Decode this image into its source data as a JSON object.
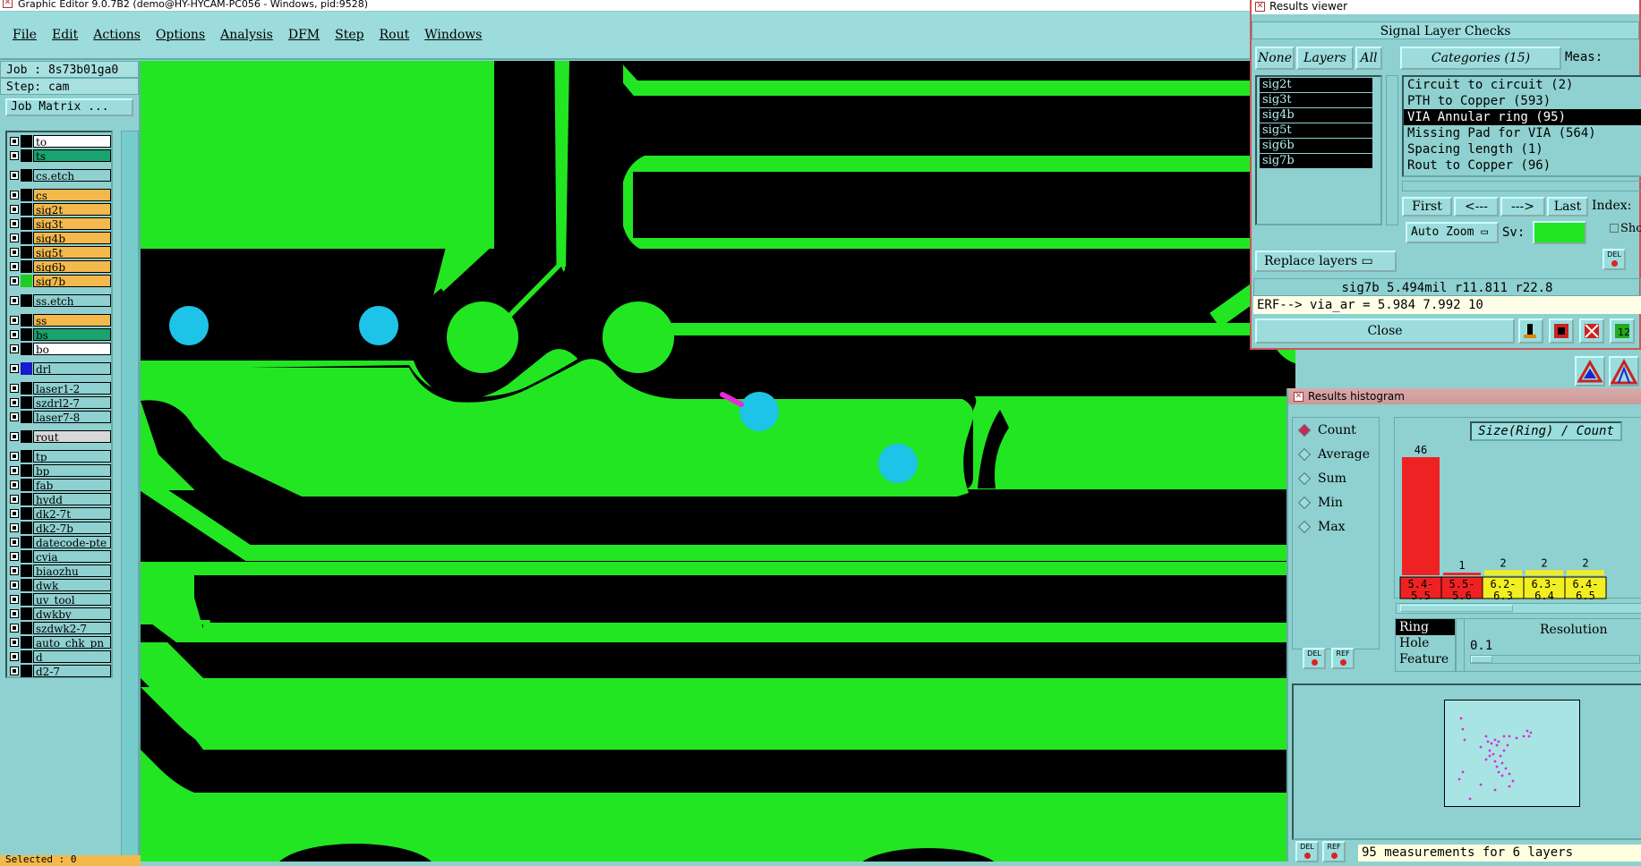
{
  "window": {
    "title": "Graphic Editor 9.0.7B2 (demo@HY-HYCAM-PC056 - Windows, pid:9528)"
  },
  "menu": [
    "File",
    "Edit",
    "Actions",
    "Options",
    "Analysis",
    "DFM",
    "Step",
    "Rout",
    "Windows"
  ],
  "job": {
    "job_line": "Job : 8s73b01ga0",
    "step_line": "Step: cam",
    "matrix_button": "Job Matrix ..."
  },
  "layers": [
    {
      "name": "to",
      "color": "#ffffff",
      "swatch": "#000000"
    },
    {
      "name": "ts",
      "color": "#1aa36f",
      "swatch": "#000000"
    },
    {
      "gap": true
    },
    {
      "name": "cs.etch",
      "color": "#8fd0d0",
      "swatch": "#000000"
    },
    {
      "gap": true
    },
    {
      "name": "cs",
      "color": "#f3b94c",
      "swatch": "#000000"
    },
    {
      "name": "sig2t",
      "color": "#f3b94c",
      "swatch": "#000000"
    },
    {
      "name": "sig3t",
      "color": "#f3b94c",
      "swatch": "#000000"
    },
    {
      "name": "sig4b",
      "color": "#f3b94c",
      "swatch": "#000000"
    },
    {
      "name": "sig5t",
      "color": "#f3b94c",
      "swatch": "#000000"
    },
    {
      "name": "sig6b",
      "color": "#f3b94c",
      "swatch": "#000000"
    },
    {
      "name": "sig7b",
      "color": "#f3b94c",
      "swatch": "#22cc22"
    },
    {
      "gap": true
    },
    {
      "name": "ss.etch",
      "color": "#8fd0d0",
      "swatch": "#000000"
    },
    {
      "gap": true
    },
    {
      "name": "ss",
      "color": "#f3b94c",
      "swatch": "#000000"
    },
    {
      "name": "bs",
      "color": "#1aa36f",
      "swatch": "#000000"
    },
    {
      "name": "bo",
      "color": "#ffffff",
      "swatch": "#000000"
    },
    {
      "gap": true
    },
    {
      "name": "drl",
      "color": "#8fd0d0",
      "swatch": "#1a1acc"
    },
    {
      "gap": true
    },
    {
      "name": "laser1-2",
      "color": "#8fd0d0",
      "swatch": "#000000"
    },
    {
      "name": "szdrl2-7",
      "color": "#8fd0d0",
      "swatch": "#000000"
    },
    {
      "name": "laser7-8",
      "color": "#8fd0d0",
      "swatch": "#000000"
    },
    {
      "gap": true
    },
    {
      "name": "rout",
      "color": "#d8d8d8",
      "swatch": "#000000"
    },
    {
      "gap": true
    },
    {
      "name": "tp",
      "color": "#8fd0d0",
      "swatch": "#000000"
    },
    {
      "name": "bp",
      "color": "#8fd0d0",
      "swatch": "#000000"
    },
    {
      "name": "fab",
      "color": "#8fd0d0",
      "swatch": "#000000"
    },
    {
      "name": "hydd",
      "color": "#8fd0d0",
      "swatch": "#000000"
    },
    {
      "name": "dk2-7t",
      "color": "#8fd0d0",
      "swatch": "#000000"
    },
    {
      "name": "dk2-7b",
      "color": "#8fd0d0",
      "swatch": "#000000"
    },
    {
      "name": "datecode-pte",
      "color": "#8fd0d0",
      "swatch": "#000000"
    },
    {
      "name": "cvia",
      "color": "#8fd0d0",
      "swatch": "#000000"
    },
    {
      "name": "biaozhu",
      "color": "#8fd0d0",
      "swatch": "#000000"
    },
    {
      "name": "dwk",
      "color": "#8fd0d0",
      "swatch": "#000000"
    },
    {
      "name": "uv_tool",
      "color": "#8fd0d0",
      "swatch": "#000000"
    },
    {
      "name": "dwkby",
      "color": "#8fd0d0",
      "swatch": "#000000"
    },
    {
      "name": "szdwk2-7",
      "color": "#8fd0d0",
      "swatch": "#000000"
    },
    {
      "name": "auto_chk_pn",
      "color": "#8fd0d0",
      "swatch": "#000000"
    },
    {
      "name": "d",
      "color": "#8fd0d0",
      "swatch": "#000000"
    },
    {
      "name": "d2-7",
      "color": "#8fd0d0",
      "swatch": "#000000"
    }
  ],
  "selected_status": "Selected : 0",
  "results_viewer": {
    "title": "Results viewer",
    "header": "Signal Layer Checks",
    "none_label": "None",
    "layers_label": "Layers",
    "all_label": "All",
    "categories_label": "Categories (15)",
    "meas_label": "Meas:",
    "layers": [
      "sig2t",
      "sig3t",
      "sig4b",
      "sig5t",
      "sig6b",
      "sig7b"
    ],
    "categories": [
      {
        "label": "Circuit to circuit (2)",
        "selected": false
      },
      {
        "label": "PTH to Copper (593)",
        "selected": false
      },
      {
        "label": "VIA Annular ring (95)",
        "selected": true
      },
      {
        "label": "Missing Pad for VIA (564)",
        "selected": false
      },
      {
        "label": "Spacing length (1)",
        "selected": false
      },
      {
        "label": "Rout to Copper (96)",
        "selected": false
      }
    ],
    "nav": {
      "first": "First",
      "prev": "<---",
      "next": "--->",
      "last": "Last",
      "index": "Index:"
    },
    "zoom": "Auto Zoom",
    "sv_label": "Sv:",
    "show_label": "Sho",
    "replace_layers": "Replace layers",
    "status": "sig7b 5.494mil  r11.811  r22.8",
    "erf": "ERF--> via_ar = 5.984 7.992 10",
    "close": "Close"
  },
  "histogram": {
    "title": "Results histogram",
    "modes": [
      {
        "label": "Count",
        "on": true
      },
      {
        "label": "Average",
        "on": false
      },
      {
        "label": "Sum",
        "on": false
      },
      {
        "label": "Min",
        "on": false
      },
      {
        "label": "Max",
        "on": false
      }
    ],
    "chart_title": "Size(Ring) / Count",
    "features": [
      {
        "label": "Ring",
        "selected": true
      },
      {
        "label": "Hole",
        "selected": false
      },
      {
        "label": "Feature",
        "selected": false
      }
    ],
    "resolution_label": "Resolution",
    "resolution_value": "0.1",
    "footer": "95 measurements for 6 layers",
    "del_label": "DEL",
    "ref_label": "REF"
  },
  "chart_data": {
    "type": "bar",
    "title": "Size(Ring) / Count",
    "categories": [
      "5.4-5.5",
      "5.5-5.6",
      "6.2-6.3",
      "6.3-6.4",
      "6.4-6.5"
    ],
    "category_lines": [
      [
        "5.4-",
        "5.5"
      ],
      [
        "5.5-",
        "5.6"
      ],
      [
        "6.2-",
        "6.3"
      ],
      [
        "6.3-",
        "6.4"
      ],
      [
        "6.4-",
        "6.5"
      ]
    ],
    "values": [
      46,
      1,
      2,
      2,
      2
    ],
    "colors": [
      "#ee2222",
      "#ee2222",
      "#f3ee22",
      "#f3ee22",
      "#f3ee22"
    ]
  }
}
